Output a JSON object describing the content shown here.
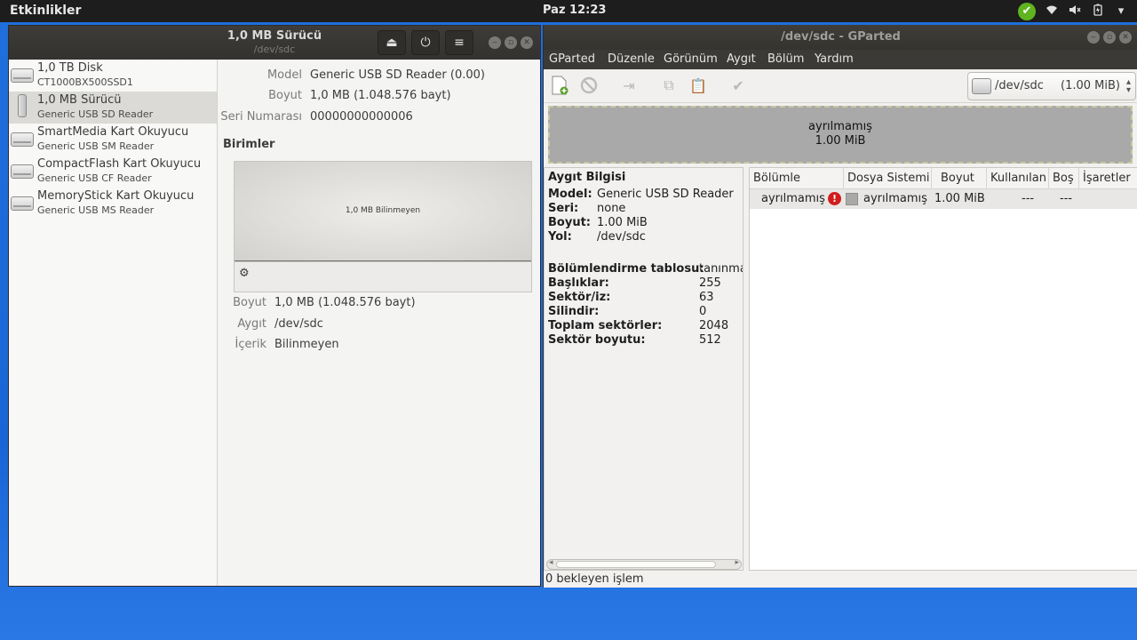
{
  "topbar": {
    "activities": "Etkinlikler",
    "clock": "Paz 12:23",
    "icons": [
      "update-check-icon",
      "wifi-icon",
      "volume-icon",
      "battery-icon",
      "menu-arrow-icon"
    ]
  },
  "disks": {
    "title": "1,0 MB Sürücü",
    "subtitle": "/dev/sdc",
    "header_buttons": [
      "eject-icon",
      "power-icon",
      "menu-icon"
    ],
    "drives": [
      {
        "name": "1,0 TB Disk",
        "desc": "CT1000BX500SSD1",
        "icon": "hdd-icon"
      },
      {
        "name": "1,0 MB Sürücü",
        "desc": "Generic USB  SD Reader",
        "icon": "usb-icon",
        "selected": true
      },
      {
        "name": "SmartMedia Kart Okuyucu",
        "desc": "Generic USB  SM Reader",
        "icon": "hdd-icon"
      },
      {
        "name": "CompactFlash Kart Okuyucu",
        "desc": "Generic USB  CF Reader",
        "icon": "hdd-icon"
      },
      {
        "name": "MemoryStick Kart Okuyucu",
        "desc": "Generic USB  MS Reader",
        "icon": "hdd-icon"
      }
    ],
    "details": {
      "model_label": "Model",
      "model_value": "Generic USB  SD Reader (0.00)",
      "size_label": "Boyut",
      "size_value": "1,0 MB (1.048.576 bayt)",
      "serial_label": "Seri Numarası",
      "serial_value": "00000000000006"
    },
    "volumes_heading": "Birimler",
    "volume_bar_label": "1,0 MB Bilinmeyen",
    "volume": {
      "size_label": "Boyut",
      "size_value": "1,0 MB (1.048.576 bayt)",
      "device_label": "Aygıt",
      "device_value": "/dev/sdc",
      "content_label": "İçerik",
      "content_value": "Bilinmeyen"
    }
  },
  "gparted": {
    "title": "/dev/sdc - GParted",
    "menu": [
      "GParted",
      "Düzenle",
      "Görünüm",
      "Aygıt",
      "Bölüm",
      "Yardım"
    ],
    "toolbar_icons": [
      "new-partition-icon",
      "delete-icon",
      "resize-move-icon",
      "copy-icon",
      "paste-icon",
      "apply-icon"
    ],
    "device_selector": {
      "name": "/dev/sdc",
      "size": "(1.00 MiB)"
    },
    "bar": {
      "line1": "ayrılmamış",
      "line2": "1.00 MiB"
    },
    "info": {
      "heading": "Aygıt Bilgisi",
      "rows1": [
        {
          "k": "Model:",
          "v": "Generic USB SD Reader"
        },
        {
          "k": "Seri:",
          "v": "none"
        },
        {
          "k": "Boyut:",
          "v": "1.00 MiB"
        },
        {
          "k": "Yol:",
          "v": "/dev/sdc"
        }
      ],
      "rows2": [
        {
          "k": "Bölümlendirme tablosu:",
          "v": "tanınma"
        },
        {
          "k": "Başlıklar:",
          "v": "255"
        },
        {
          "k": "Sektör/iz:",
          "v": "63"
        },
        {
          "k": "Silindir:",
          "v": "0"
        },
        {
          "k": "Toplam sektörler:",
          "v": "2048"
        },
        {
          "k": "Sektör boyutu:",
          "v": "512"
        }
      ]
    },
    "table": {
      "headers": [
        "Bölümle",
        "Dosya Sistemi",
        "Boyut",
        "Kullanılan",
        "Boş",
        "İşaretler"
      ],
      "row": {
        "partition": "ayrılmamış",
        "fs": "ayrılmamış",
        "size": "1.00 MiB",
        "used": "---",
        "free": "---",
        "flags": ""
      }
    },
    "status": "0 bekleyen işlem"
  }
}
